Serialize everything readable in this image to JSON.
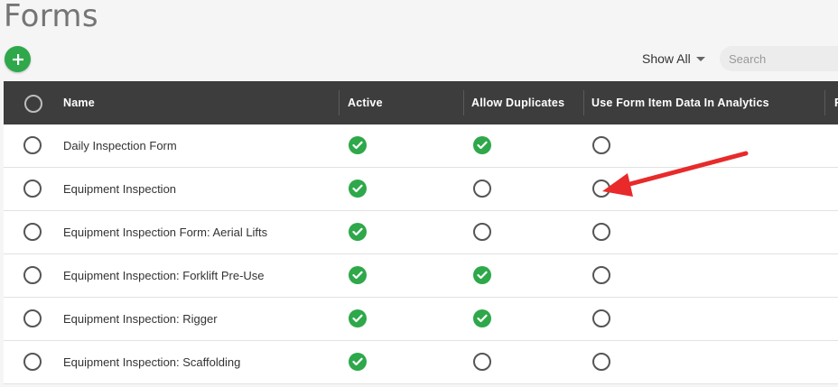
{
  "page": {
    "title": "Forms"
  },
  "toolbar": {
    "add_label": "+",
    "filter_label": "Show All",
    "search_placeholder": "Search"
  },
  "colors": {
    "header_bg": "#3d3d3d",
    "check_green": "#2ea84a",
    "arrow_red": "#e82a2a"
  },
  "table": {
    "columns": [
      "Name",
      "Active",
      "Allow Duplicates",
      "Use Form Item Data In Analytics",
      "F"
    ],
    "rows": [
      {
        "name": "Daily Inspection Form",
        "active": true,
        "allow_duplicates": true,
        "use_in_analytics": false
      },
      {
        "name": "Equipment Inspection",
        "active": true,
        "allow_duplicates": false,
        "use_in_analytics": false
      },
      {
        "name": "Equipment Inspection Form: Aerial Lifts",
        "active": true,
        "allow_duplicates": false,
        "use_in_analytics": false
      },
      {
        "name": "Equipment Inspection: Forklift Pre-Use",
        "active": true,
        "allow_duplicates": true,
        "use_in_analytics": false
      },
      {
        "name": "Equipment Inspection: Rigger",
        "active": true,
        "allow_duplicates": true,
        "use_in_analytics": false
      },
      {
        "name": "Equipment Inspection: Scaffolding",
        "active": true,
        "allow_duplicates": false,
        "use_in_analytics": false
      }
    ]
  },
  "annotation": {
    "type": "arrow",
    "target": "Use Form Item Data In Analytics — Equipment Inspection"
  }
}
